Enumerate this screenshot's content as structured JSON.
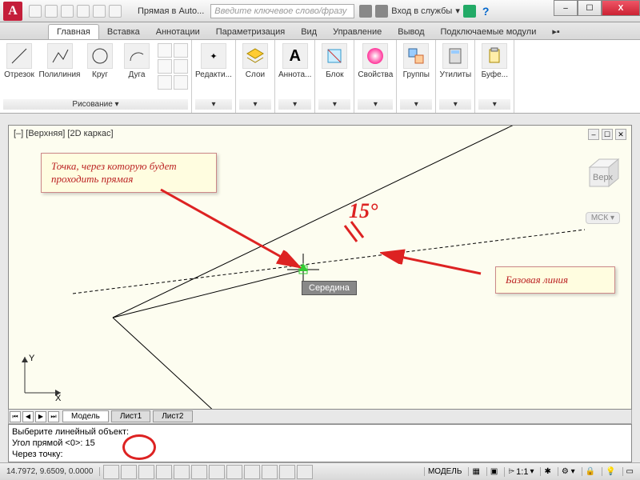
{
  "titlebar": {
    "app_letter": "A",
    "title": "Прямая в Auto...",
    "search_placeholder": "Введите ключевое слово/фразу",
    "login": "Вход в службы"
  },
  "win": {
    "min": "–",
    "max": "☐",
    "close": "X"
  },
  "tabs": [
    "Главная",
    "Вставка",
    "Аннотации",
    "Параметризация",
    "Вид",
    "Управление",
    "Вывод",
    "Подключаемые модули"
  ],
  "active_tab": 0,
  "ribbon": {
    "draw": {
      "segment": "Отрезок",
      "polyline": "Полилиния",
      "circle": "Круг",
      "arc": "Дуга",
      "title": "Рисование ▾"
    },
    "edit": {
      "label": "Редакти...",
      "title": "▾"
    },
    "layers": {
      "label": "Слои",
      "title": "▾"
    },
    "anno": {
      "label": "Аннота...",
      "title": "▾"
    },
    "block": {
      "label": "Блок",
      "title": "▾"
    },
    "props": {
      "label": "Свойства",
      "title": "▾"
    },
    "groups": {
      "label": "Группы",
      "title": "▾"
    },
    "utils": {
      "label": "Утилиты",
      "title": "▾"
    },
    "buffer": {
      "label": "Буфе...",
      "title": "▾"
    }
  },
  "viewport": {
    "label": "[–] [Верхняя] [2D каркас]",
    "msk": "МСК ▾"
  },
  "callouts": {
    "c1": "Точка, через которую будет проходить прямая",
    "c2": "Базовая линия"
  },
  "tooltip": "Середина",
  "angle": "15°",
  "ucs": {
    "x": "X",
    "y": "Y"
  },
  "model_tabs": {
    "model": "Модель",
    "s1": "Лист1",
    "s2": "Лист2"
  },
  "cmd": {
    "l1": "Выберите линейный объект:",
    "l2": "Угол прямой <0>: 15",
    "l3": "Через точку:"
  },
  "status": {
    "coords": "14.7972, 9.6509, 0.0000",
    "model": "МОДЕЛЬ",
    "scale": "1:1"
  }
}
